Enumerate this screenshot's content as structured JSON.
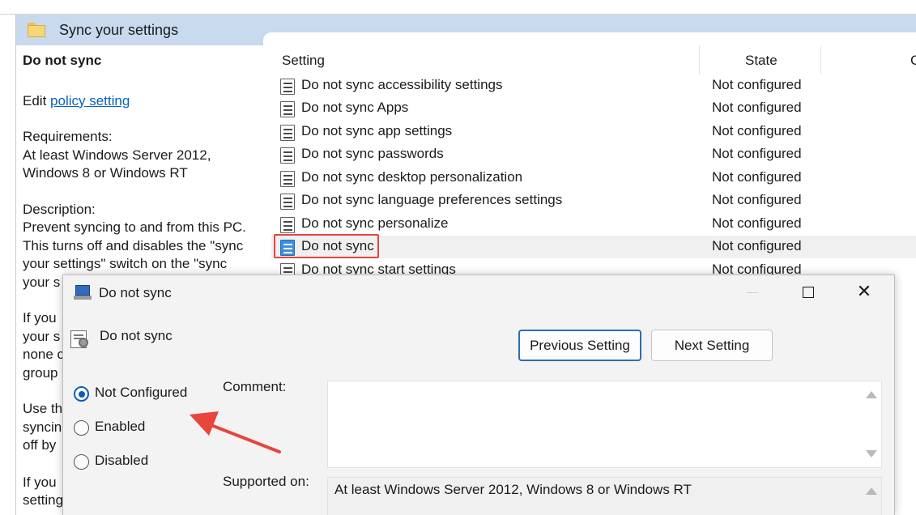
{
  "window": {
    "title": "Sync your settings"
  },
  "description": {
    "title": "Do not sync",
    "edit_prefix": "Edit ",
    "edit_link": "policy setting ",
    "requirements_label": "Requirements:",
    "requirements_line1": "At least Windows Server 2012,",
    "requirements_line2": "Windows 8 or Windows RT",
    "description_label": "Description:",
    "description_lines": [
      "Prevent syncing to and from this PC.",
      "This turns off and disables the \"sync",
      "your settings\" switch on the \"sync",
      "your s"
    ],
    "para2_lines": [
      "If you",
      "your s",
      "none c",
      "group"
    ],
    "para3_lines": [
      "Use th",
      "syncin",
      "off by"
    ],
    "para4_lines": [
      "If you",
      "setting"
    ]
  },
  "list": {
    "columns": [
      "Setting",
      "State",
      "C"
    ],
    "rows": [
      {
        "name": "Do not sync accessibility settings",
        "state": "Not configured"
      },
      {
        "name": "Do not sync Apps",
        "state": "Not configured"
      },
      {
        "name": "Do not sync app settings",
        "state": "Not configured"
      },
      {
        "name": "Do not sync passwords",
        "state": "Not configured"
      },
      {
        "name": "Do not sync desktop personalization",
        "state": "Not configured"
      },
      {
        "name": "Do not sync language preferences settings",
        "state": "Not configured"
      },
      {
        "name": "Do not sync personalize",
        "state": "Not configured"
      },
      {
        "name": "Do not sync",
        "state": "Not configured"
      },
      {
        "name": "Do not sync start settings",
        "state": "Not configured"
      }
    ],
    "selected_index": 7
  },
  "dialog": {
    "title": "Do not sync",
    "policy_name": "Do not sync",
    "previous_button": "Previous Setting",
    "next_button": "Next Setting",
    "options": [
      {
        "label": "Not Configured",
        "checked": true
      },
      {
        "label": "Enabled",
        "checked": false
      },
      {
        "label": "Disabled",
        "checked": false
      }
    ],
    "comment_label": "Comment:",
    "comment_value": "",
    "supported_label": "Supported on:",
    "supported_value": "At least Windows Server 2012, Windows 8 or Windows RT"
  },
  "annotation": {
    "arrow_color": "#e8453c",
    "highlight_color": "#e8453c"
  },
  "icons": [
    "folder-icon",
    "policy-setting-icon",
    "dialog-app-icon",
    "minimize-icon",
    "maximize-icon",
    "close-icon",
    "scroll-up-icon",
    "scroll-down-icon"
  ]
}
